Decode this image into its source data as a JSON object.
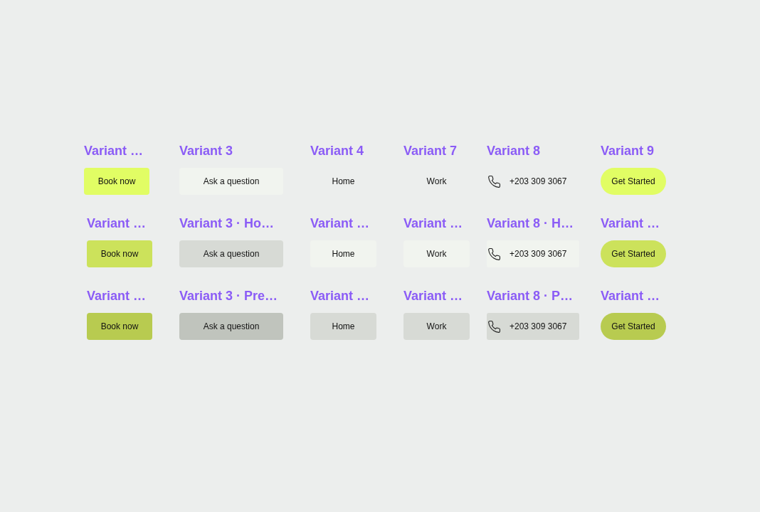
{
  "rows": [
    {
      "kind": "default",
      "cells": [
        {
          "label": "Variant …",
          "button": {
            "kind": "primary",
            "text": "Book now"
          }
        },
        {
          "label": "Variant 3",
          "button": {
            "kind": "soft",
            "text": "Ask a question"
          }
        },
        {
          "label": "Variant 4",
          "button": {
            "kind": "ghost",
            "text": "Home"
          }
        },
        {
          "label": "Variant 7",
          "button": {
            "kind": "ghost",
            "text": "Work"
          }
        },
        {
          "label": "Variant 8",
          "button": {
            "kind": "phone",
            "text": "+203 309 3067"
          }
        },
        {
          "label": "Variant 9",
          "button": {
            "kind": "pill",
            "text": "Get Started"
          }
        }
      ]
    },
    {
      "kind": "hover",
      "cells": [
        {
          "label": "Variant …",
          "button": {
            "kind": "primary",
            "text": "Book now"
          }
        },
        {
          "label": "Variant 3 · Ho…",
          "button": {
            "kind": "soft",
            "text": "Ask a question"
          }
        },
        {
          "label": "Variant …",
          "button": {
            "kind": "ghost",
            "text": "Home"
          }
        },
        {
          "label": "Variant …",
          "button": {
            "kind": "ghost",
            "text": "Work"
          }
        },
        {
          "label": "Variant 8 · H…",
          "button": {
            "kind": "phone",
            "text": "+203 309 3067"
          }
        },
        {
          "label": "Variant …",
          "button": {
            "kind": "pill",
            "text": "Get Started"
          }
        }
      ]
    },
    {
      "kind": "pressed",
      "cells": [
        {
          "label": "Variant …",
          "button": {
            "kind": "primary",
            "text": "Book now"
          }
        },
        {
          "label": "Variant 3 · Pre…",
          "button": {
            "kind": "soft",
            "text": "Ask a question"
          }
        },
        {
          "label": "Variant …",
          "button": {
            "kind": "ghost",
            "text": "Home"
          }
        },
        {
          "label": "Variant …",
          "button": {
            "kind": "ghost",
            "text": "Work"
          }
        },
        {
          "label": "Variant 8 · P…",
          "button": {
            "kind": "phone",
            "text": "+203 309 3067"
          }
        },
        {
          "label": "Variant …",
          "button": {
            "kind": "pill",
            "text": "Get Started"
          }
        }
      ]
    }
  ]
}
